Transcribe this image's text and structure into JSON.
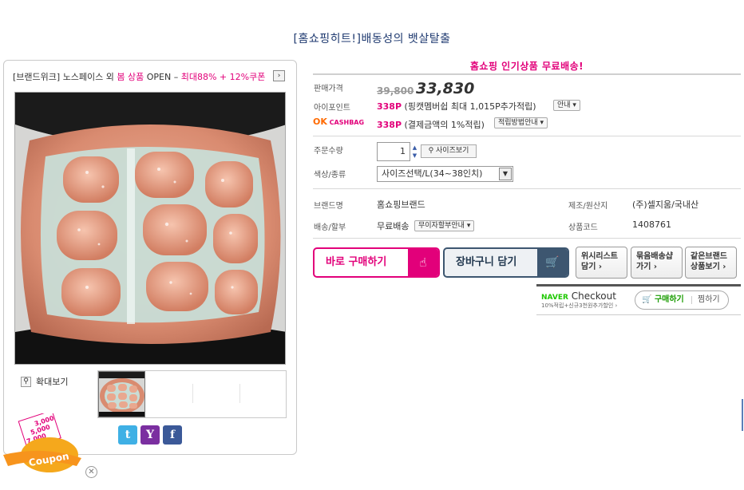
{
  "page_title": "[홈쇼핑히트!]배동성의 뱃살탈출",
  "promo": {
    "brand": "[브랜드위크]",
    "text1": "노스페이스 외 ",
    "highlight1": "봄 상품",
    "text2": " OPEN – ",
    "highlight2": "최대88% + 12%쿠폰",
    "arrow": "›"
  },
  "gallery": {
    "zoom_label": "확대보기"
  },
  "free_shipping_banner": "홈쇼핑 인기상품 무료배송!",
  "price": {
    "label": "판매가격",
    "original": "39,800",
    "sale": "33,830"
  },
  "ipoint": {
    "label": "아이포인트",
    "points": "338P",
    "desc": "(핑캣멤버쉽 최대 1,015P추가적립)",
    "button": "안내 ▾"
  },
  "okcashbag": {
    "logo_ok": "OK",
    "logo_text": "CASHBAG",
    "points": "338P",
    "desc": "(결제금액의 1%적립)",
    "button": "적립방법안내 ▾"
  },
  "order": {
    "qty_label": "주문수량",
    "qty_value": "1",
    "size_button": "사이즈보기",
    "option_label": "색상/종류",
    "option_value": "사이즈선택/L(34~38인치)"
  },
  "info": {
    "brand_label": "브랜드명",
    "brand_value": "홈쇼핑브랜드",
    "origin_label": "제조/원산지",
    "origin_value": "(주)셀지움/국내산",
    "shipping_label": "배송/할부",
    "shipping_value": "무료배송",
    "installment_button": "무이자할부안내 ▾",
    "code_label": "상품코드",
    "code_value": "1408761"
  },
  "actions": {
    "buy_now": "바로 구매하기",
    "cart": "장바구니 담기",
    "wishlist_l1": "위시리스트",
    "wishlist_l2": "담기 ›",
    "bundle_l1": "묶음배송샵",
    "bundle_l2": "가기 ›",
    "same_brand_l1": "같은브랜드",
    "same_brand_l2": "상품보기 ›"
  },
  "naver": {
    "brand": "NAVER",
    "checkout": "Checkout",
    "sub": "10%적립+신규3천원추가할인 ›",
    "buy": "구매하기",
    "wish": "찜하기"
  },
  "coupon": {
    "label": "Coupon",
    "amount1": "3,000",
    "amount2": "5,000",
    "amount3": "7,000"
  },
  "colors": {
    "accent": "#e2007a",
    "title": "#1f3a70",
    "cart": "#3d5670",
    "naver": "#1ec800"
  }
}
